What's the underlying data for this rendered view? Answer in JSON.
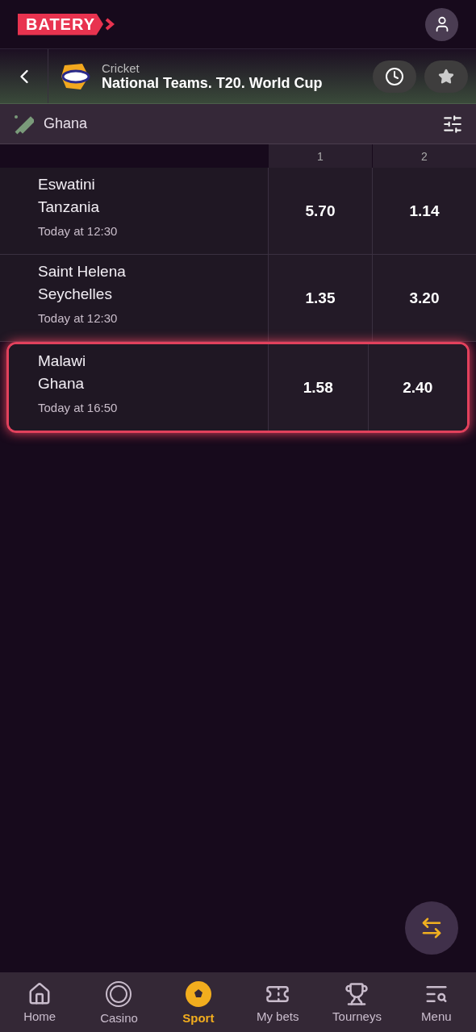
{
  "header": {
    "logo": "BATERY"
  },
  "tournament": {
    "sport": "Cricket",
    "title": "National Teams. T20. World Cup"
  },
  "filter": {
    "label": "Ghana"
  },
  "table": {
    "columns": [
      "1",
      "2"
    ],
    "rows": [
      {
        "team_1": "Eswatini",
        "team_2": "Tanzania",
        "time": "Today at 12:30",
        "odds": [
          "5.70",
          "1.14"
        ],
        "highlighted": false
      },
      {
        "team_1": "Saint Helena",
        "team_2": "Seychelles",
        "time": "Today at 12:30",
        "odds": [
          "1.35",
          "3.20"
        ],
        "highlighted": false
      },
      {
        "team_1": "Malawi",
        "team_2": "Ghana",
        "time": "Today at 16:50",
        "odds": [
          "1.58",
          "2.40"
        ],
        "highlighted": true
      }
    ]
  },
  "nav": [
    {
      "label": "Home",
      "selected": false
    },
    {
      "label": "Casino",
      "selected": false
    },
    {
      "label": "Sport",
      "selected": true
    },
    {
      "label": "My bets",
      "selected": false
    },
    {
      "label": "Tourneys",
      "selected": false
    },
    {
      "label": "Menu",
      "selected": false
    }
  ]
}
